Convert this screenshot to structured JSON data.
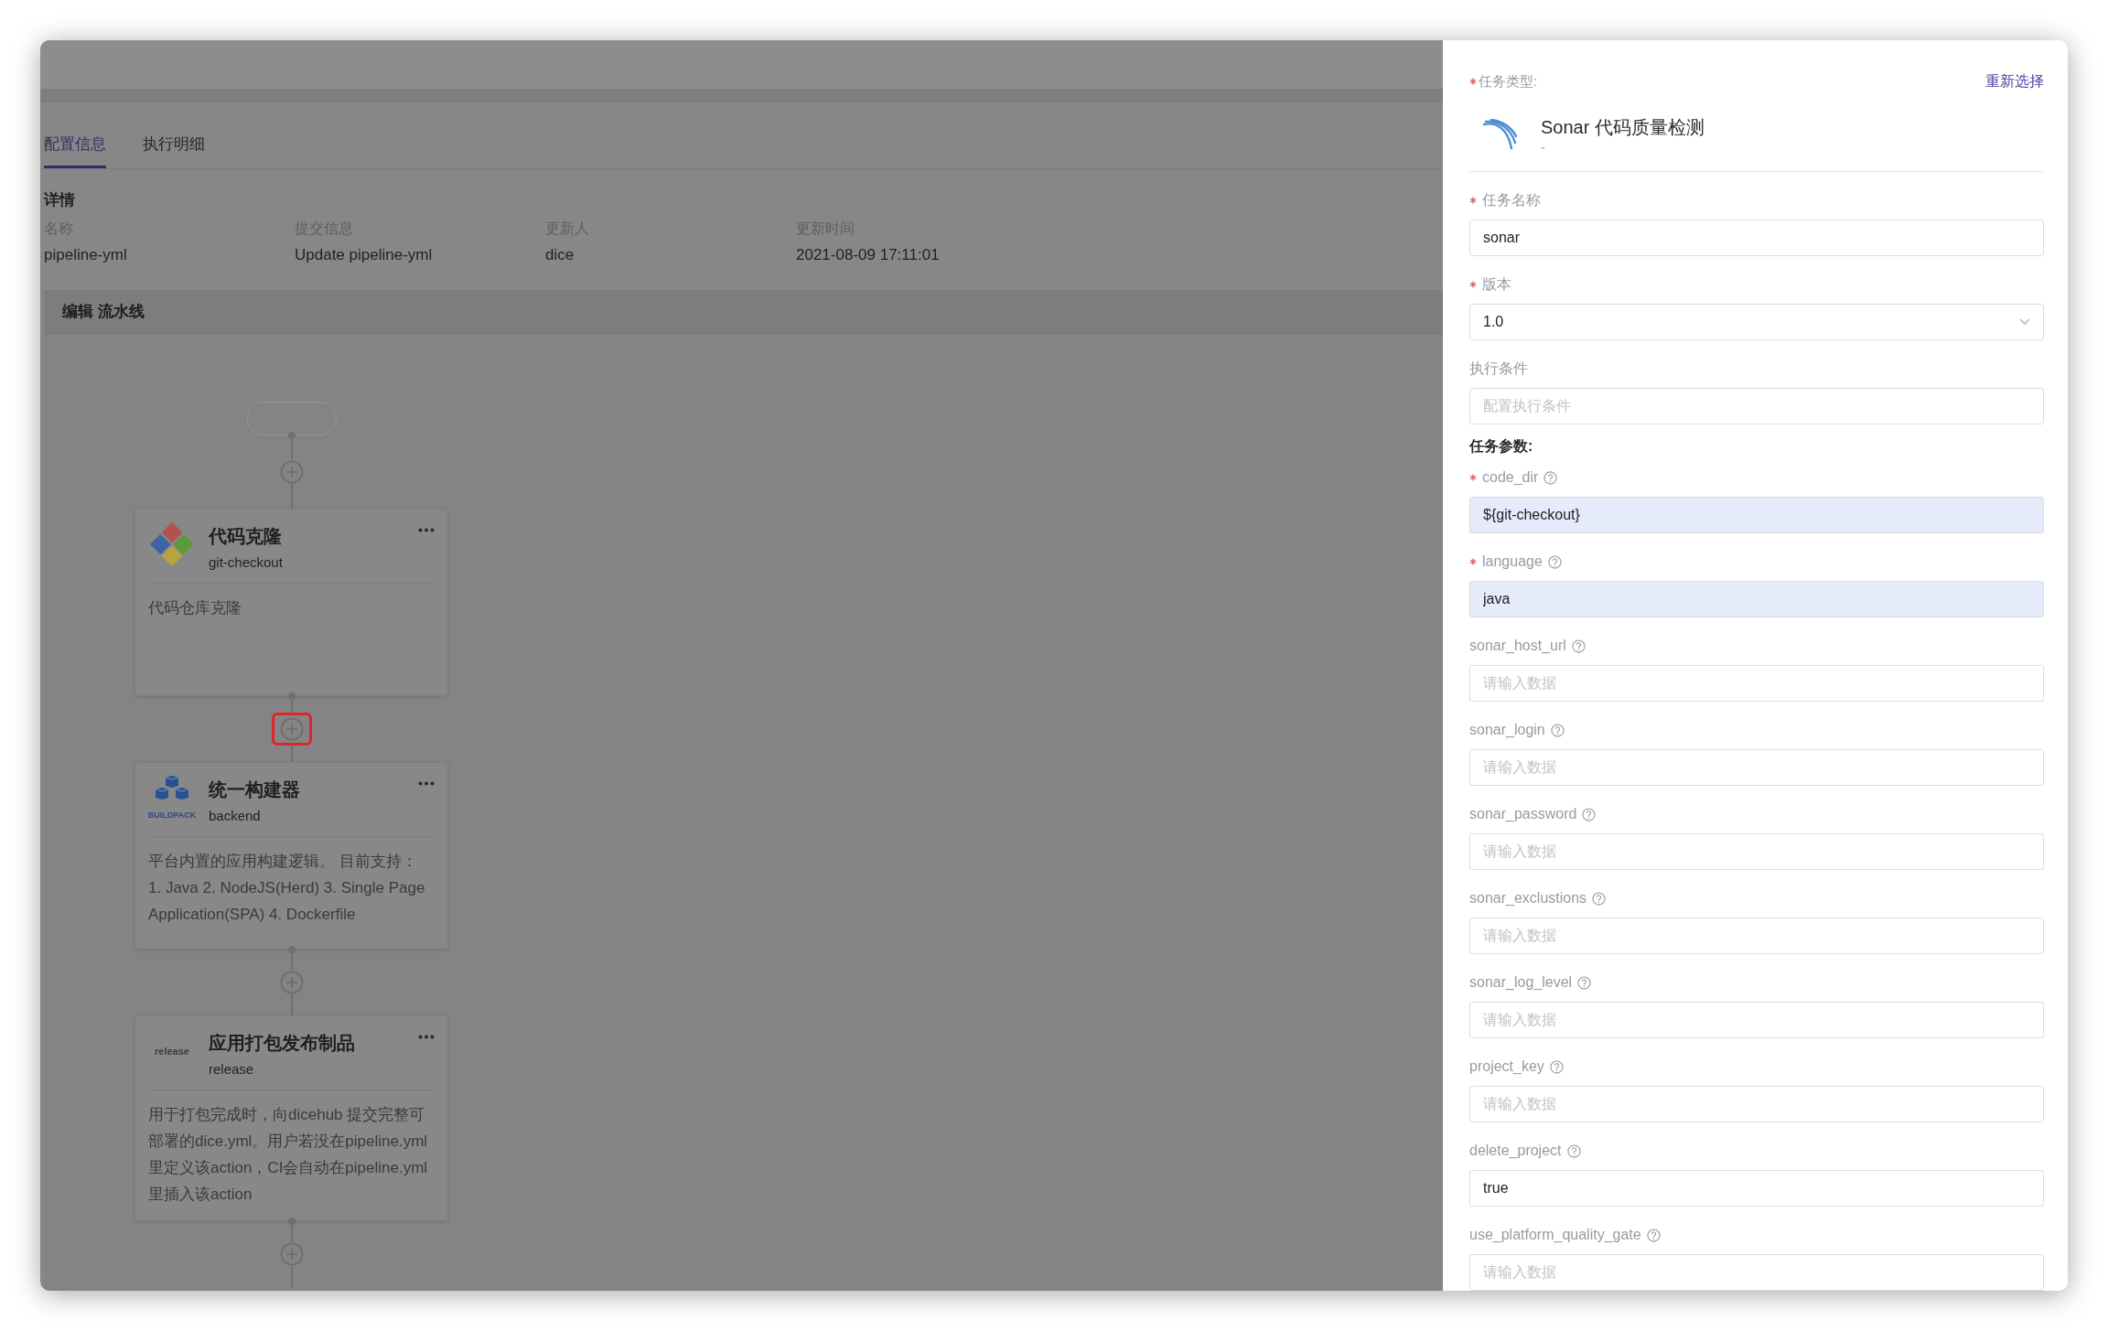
{
  "tabs": [
    {
      "label": "配置信息",
      "selected": true
    },
    {
      "label": "执行明细",
      "selected": false
    }
  ],
  "details": {
    "title": "详情",
    "fields": [
      {
        "label": "名称",
        "value": "pipeline-yml"
      },
      {
        "label": "提交信息",
        "value": "Update pipeline-yml"
      },
      {
        "label": "更新人",
        "value": "dice"
      },
      {
        "label": "更新时间",
        "value": "2021-08-09 17:11:01"
      }
    ]
  },
  "pipeline": {
    "title": "编辑 流水线",
    "add_buttons": [
      {
        "highlighted": false
      },
      {
        "highlighted": true
      },
      {
        "highlighted": false
      },
      {
        "highlighted": false
      }
    ],
    "nodes": [
      {
        "kind": "git",
        "title": "代码克隆",
        "subtitle": "git-checkout",
        "description": "代码仓库克隆"
      },
      {
        "kind": "buildpack",
        "logo_text": "BUILDPACK",
        "title": "统一构建器",
        "subtitle": "backend",
        "description": "平台内置的应用构建逻辑。 目前支持：\n1. Java 2. NodeJS(Herd) 3. Single Page Application(SPA) 4. Dockerfile"
      },
      {
        "kind": "wordmark",
        "logo_text": "release",
        "title": "应用打包发布制品",
        "subtitle": "release",
        "description": "用于打包完成时，向dicehub 提交完整可部署的dice.yml。用户若没在pipeline.yml里定义该action，CI会自动在pipeline.yml里插入该action"
      }
    ]
  },
  "drawer": {
    "task_type": {
      "label": "任务类型:",
      "required": true
    },
    "reselect_link": "重新选择",
    "selected_task": {
      "name": "Sonar 代码质量检测",
      "subtitle": "-"
    },
    "fields": [
      {
        "kind": "input",
        "label": "任务名称",
        "required": true,
        "help": false,
        "value": "sonar",
        "filled": false
      },
      {
        "kind": "select",
        "label": "版本",
        "required": true,
        "help": false,
        "value": "1.0",
        "filled": false
      },
      {
        "kind": "input",
        "label": "执行条件",
        "required": false,
        "help": false,
        "placeholder": "配置执行条件",
        "filled": false
      },
      {
        "kind": "heading",
        "label": "任务参数:"
      },
      {
        "kind": "input",
        "label": "code_dir",
        "required": true,
        "help": true,
        "value": "${git-checkout}",
        "filled": true
      },
      {
        "kind": "input",
        "label": "language",
        "required": true,
        "help": true,
        "value": "java",
        "filled": true
      },
      {
        "kind": "input",
        "label": "sonar_host_url",
        "required": false,
        "help": true,
        "placeholder": "请输入数据",
        "filled": false
      },
      {
        "kind": "input",
        "label": "sonar_login",
        "required": false,
        "help": true,
        "placeholder": "请输入数据",
        "filled": false
      },
      {
        "kind": "input",
        "label": "sonar_password",
        "required": false,
        "help": true,
        "placeholder": "请输入数据",
        "filled": false
      },
      {
        "kind": "input",
        "label": "sonar_exclustions",
        "required": false,
        "help": true,
        "placeholder": "请输入数据",
        "filled": false
      },
      {
        "kind": "input",
        "label": "sonar_log_level",
        "required": false,
        "help": true,
        "placeholder": "请输入数据",
        "filled": false
      },
      {
        "kind": "input",
        "label": "project_key",
        "required": false,
        "help": true,
        "placeholder": "请输入数据",
        "filled": false
      },
      {
        "kind": "input",
        "label": "delete_project",
        "required": false,
        "help": true,
        "value": "true",
        "filled": false
      },
      {
        "kind": "input",
        "label": "use_platform_quality_gate",
        "required": false,
        "help": true,
        "placeholder": "请输入数据",
        "filled": false
      }
    ]
  }
}
